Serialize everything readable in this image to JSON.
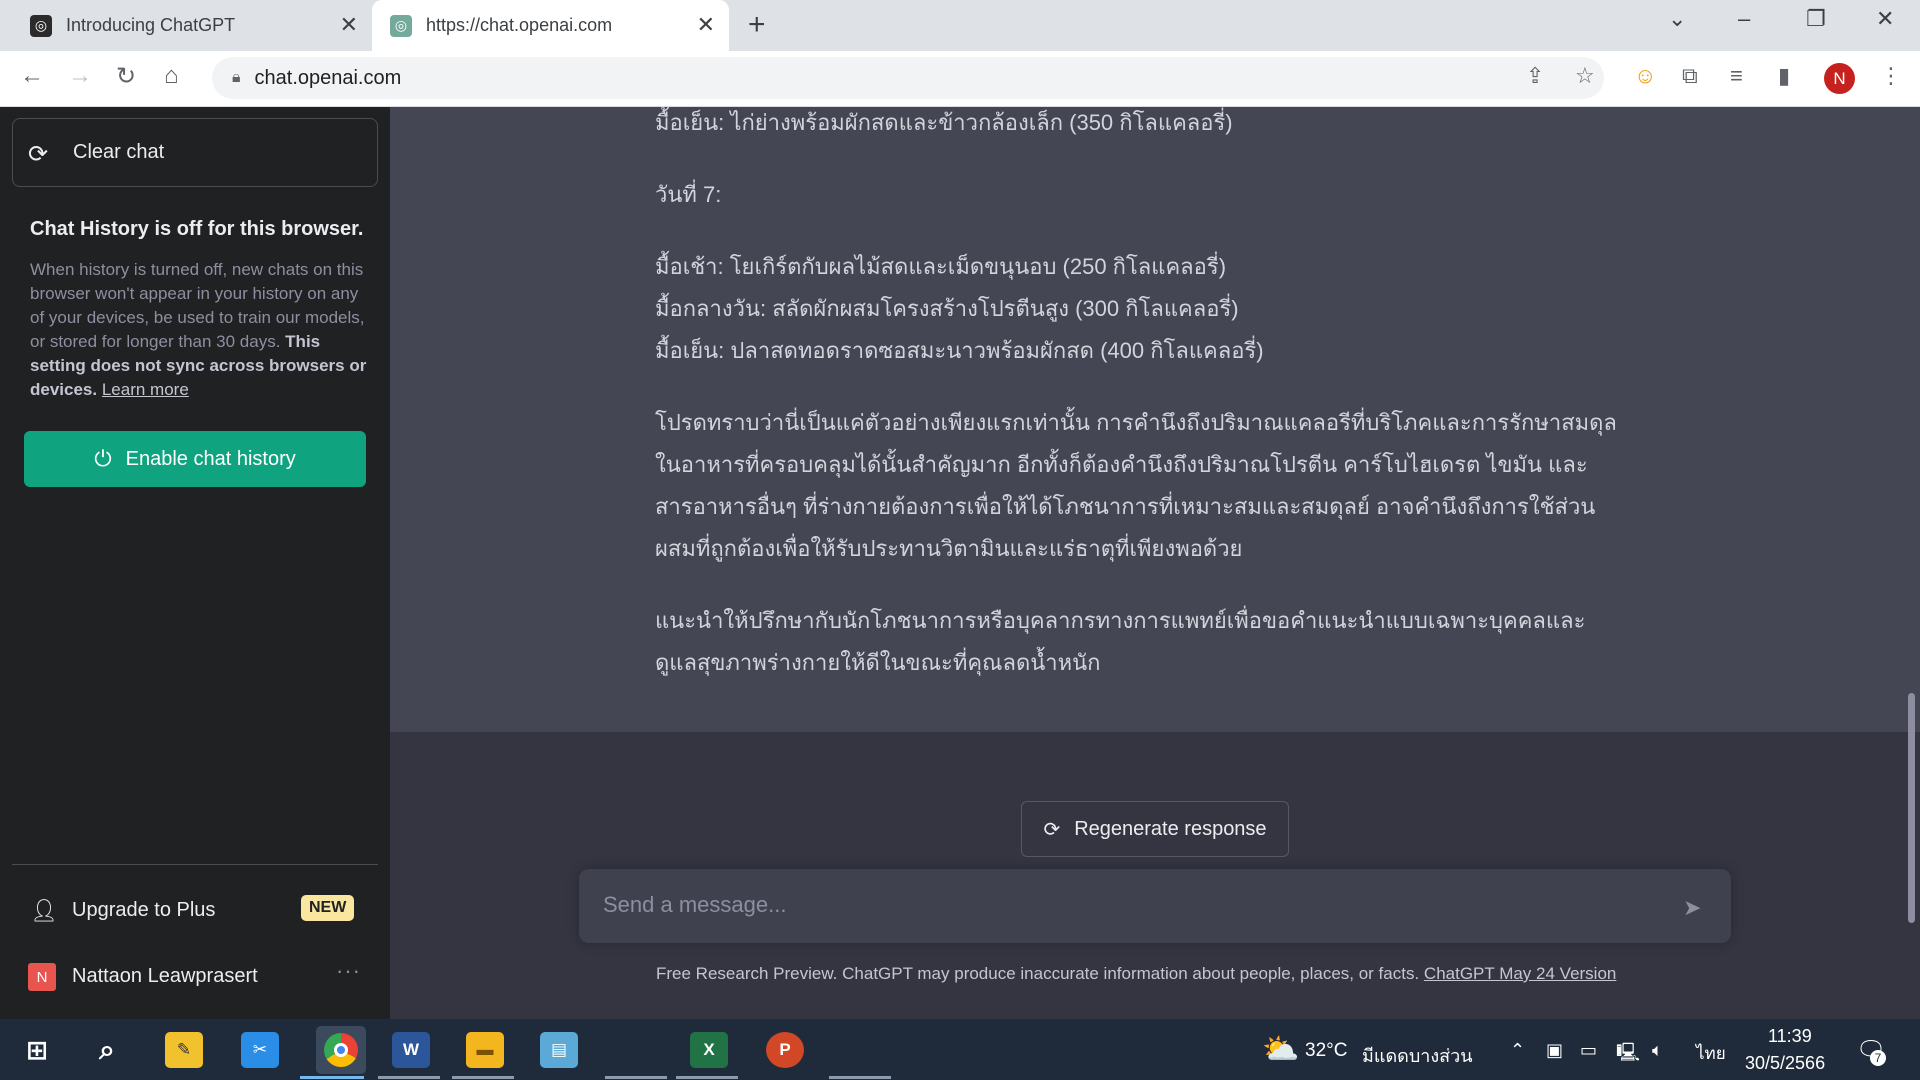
{
  "browser": {
    "tabs": [
      {
        "title": "Introducing ChatGPT",
        "close": "✕"
      },
      {
        "title": "https://chat.openai.com",
        "close": "✕"
      }
    ],
    "new_tab": "+",
    "url": "chat.openai.com",
    "profile_initial": "N"
  },
  "sidebar": {
    "clear_chat": "Clear chat",
    "history_title": "Chat History is off for this browser.",
    "history_body": "When history is turned off, new chats on this browser won't appear in your history on any of your devices, be used to train our models, or stored for longer than 30 days.",
    "history_bold": "This setting does not sync across browsers or devices.",
    "learn_more": "Learn more",
    "enable_history": "Enable chat history",
    "upgrade": "Upgrade to Plus",
    "new_badge": "NEW",
    "user_initial": "N",
    "user_name": "Nattaon Leawprasert",
    "more": "···"
  },
  "conversation": {
    "lines": [
      "มื้อเย็น: ไก่ย่างพร้อมผักสดและข้าวกล้องเล็ก (350 กิโลแคลอรี่)",
      "วันที่ 7:",
      "มื้อเช้า: โยเกิร์ตกับผลไม้สดและเม็ดขนุนอบ (250 กิโลแคลอรี่)",
      "มื้อกลางวัน: สลัดผักผสมโครงสร้างโปรตีนสูง (300 กิโลแคลอรี่)",
      "มื้อเย็น: ปลาสดทอดราดซอสมะนาวพร้อมผักสด (400 กิโลแคลอรี่)",
      "โปรดทราบว่านี่เป็นแค่ตัวอย่างเพียงแรกเท่านั้น การคำนึงถึงปริมาณแคลอรีที่บริโภคและการรักษาสมดุล",
      "ในอาหารที่ครอบคลุมได้นั้นสำคัญมาก อีกทั้งก็ต้องคำนึงถึงปริมาณโปรตีน คาร์โบไฮเดรต ไขมัน และ",
      "สารอาหารอื่นๆ ที่ร่างกายต้องการเพื่อให้ได้โภชนาการที่เหมาะสมและสมดุลย์ อาจคำนึงถึงการใช้ส่วน",
      "ผสมที่ถูกต้องเพื่อให้รับประทานวิตามินและแร่ธาตุที่เพียงพอด้วย",
      "แนะนำให้ปรึกษากับนักโภชนาการหรือบุคลากรทางการแพทย์เพื่อขอคำแนะนำแบบเฉพาะบุคคลและ",
      "ดูแลสุขภาพร่างกายให้ดีในขณะที่คุณลดน้ำหนัก"
    ]
  },
  "composer": {
    "regenerate": "Regenerate response",
    "placeholder": "Send a message...",
    "footer_text": "Free Research Preview. ChatGPT may produce inaccurate information about people, places, or facts.",
    "footer_link": "ChatGPT May 24 Version"
  },
  "taskbar": {
    "temperature": "32°C",
    "weather": "มีแดดบางส่วน",
    "language": "ไทย",
    "time": "11:39",
    "date": "30/5/2566",
    "notifications": "7"
  },
  "colors": {
    "accent": "#10a37f",
    "sidebar_bg": "#202123",
    "main_bg": "#343541",
    "answer_bg": "#444654"
  }
}
